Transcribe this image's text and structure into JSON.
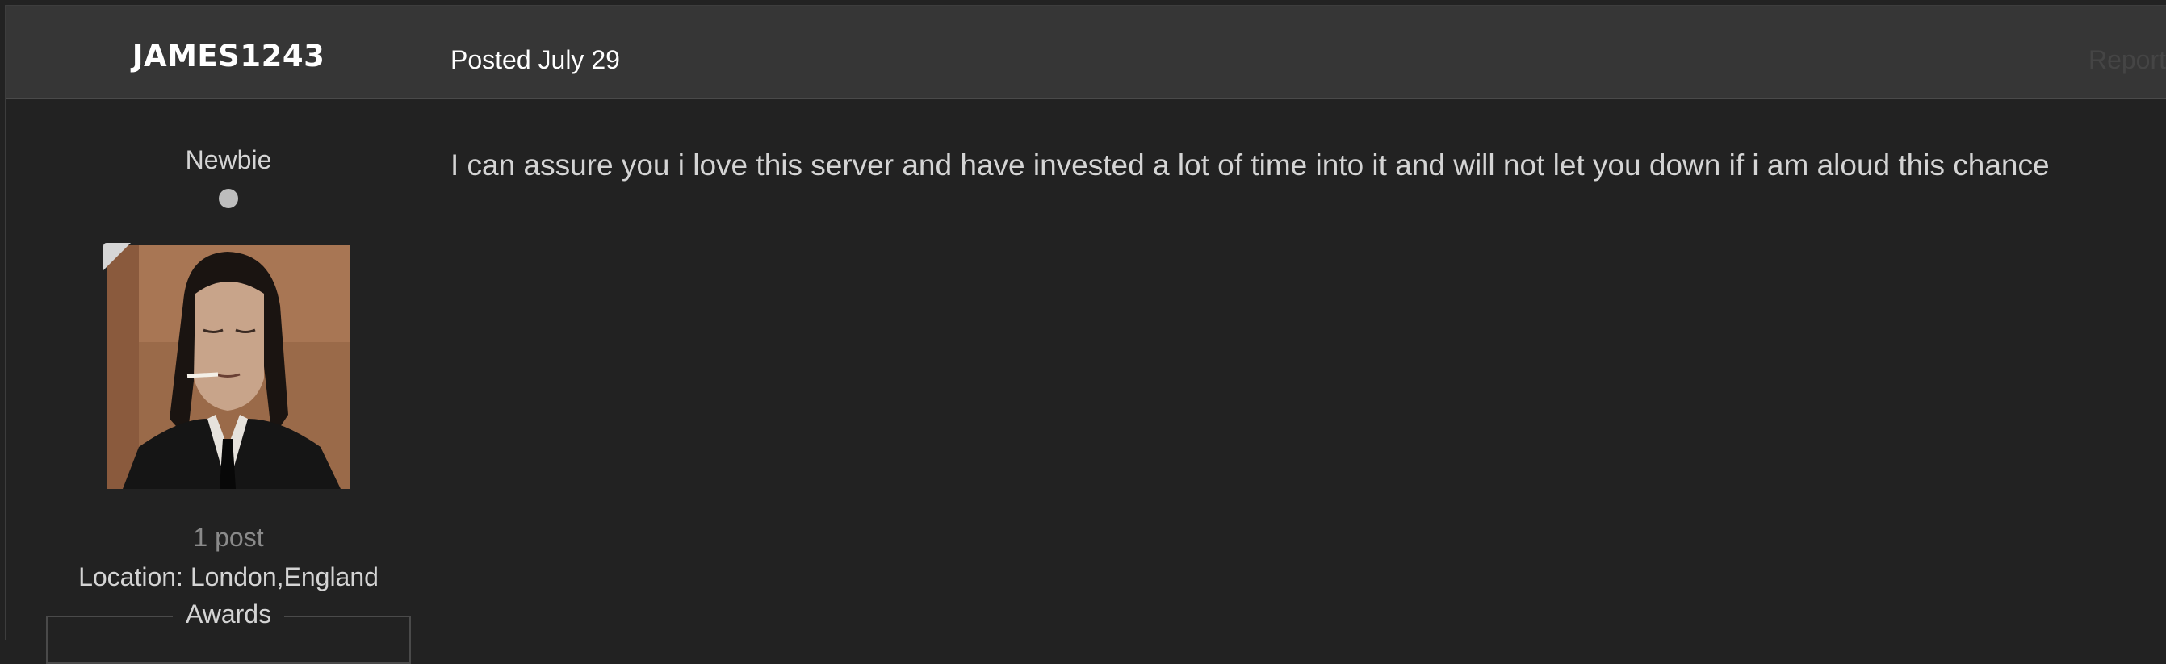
{
  "post": {
    "author": "JAMES1243",
    "posted": "Posted July 29",
    "report": "Report",
    "body": "I can assure you i love this server and have invested a lot of time into it and will not let you down if i am aloud this chance"
  },
  "author_panel": {
    "rank": "Newbie",
    "post_count": "1 post",
    "location": "Location: London,England",
    "awards": "Awards"
  },
  "colors": {
    "background": "#222222",
    "header": "#363636",
    "text": "#d4d4d4",
    "muted": "#8a8a8a"
  }
}
